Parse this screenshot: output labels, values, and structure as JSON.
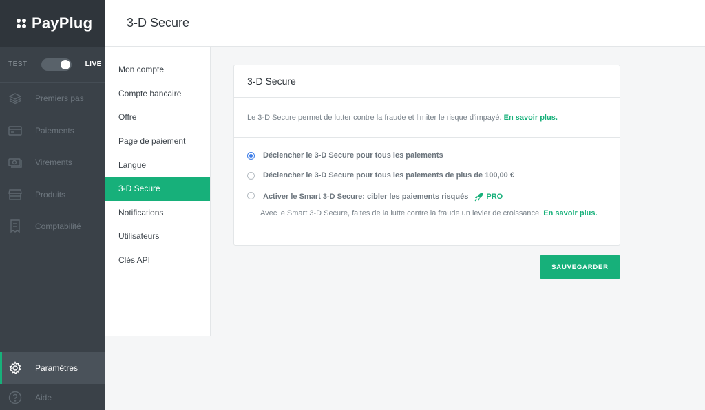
{
  "brand": {
    "name": "PayPlug"
  },
  "mode": {
    "test_label": "TEST",
    "live_label": "LIVE",
    "live_enabled": true
  },
  "sidebar": {
    "items": [
      {
        "label": "Premiers pas",
        "icon": "layers-icon"
      },
      {
        "label": "Paiements",
        "icon": "credit-card-icon"
      },
      {
        "label": "Virements",
        "icon": "banknote-icon"
      },
      {
        "label": "Produits",
        "icon": "store-icon"
      },
      {
        "label": "Comptabilité",
        "icon": "receipt-icon"
      }
    ],
    "settings_label": "Paramètres",
    "help_label": "Aide"
  },
  "header": {
    "title": "3-D Secure"
  },
  "submenu": {
    "items": [
      {
        "label": "Mon compte"
      },
      {
        "label": "Compte bancaire"
      },
      {
        "label": "Offre"
      },
      {
        "label": "Page de paiement"
      },
      {
        "label": "Langue"
      },
      {
        "label": "3-D Secure",
        "active": true
      },
      {
        "label": "Notifications"
      },
      {
        "label": "Utilisateurs"
      },
      {
        "label": "Clés API"
      }
    ]
  },
  "card": {
    "title": "3-D Secure",
    "intro": "Le 3-D Secure permet de lutter contre la fraude et limiter le risque d'impayé.",
    "intro_link": "En savoir plus.",
    "options": [
      {
        "label": "Déclencher le 3-D Secure pour tous les paiements",
        "checked": true
      },
      {
        "label": "Déclencher le 3-D Secure pour tous les paiements de plus de 100,00 €",
        "checked": false
      },
      {
        "label": "Activer le Smart 3-D Secure: cibler les paiements risqués",
        "checked": false,
        "badge": "PRO",
        "description": "Avec le Smart 3-D Secure, faites de la lutte contre la fraude un levier de croissance.",
        "description_link": "En savoir plus."
      }
    ]
  },
  "save_label": "SAUVEGARDER",
  "colors": {
    "accent": "#17b07a",
    "sidebar": "#3a4148",
    "radio_checked": "#3d7de8"
  }
}
